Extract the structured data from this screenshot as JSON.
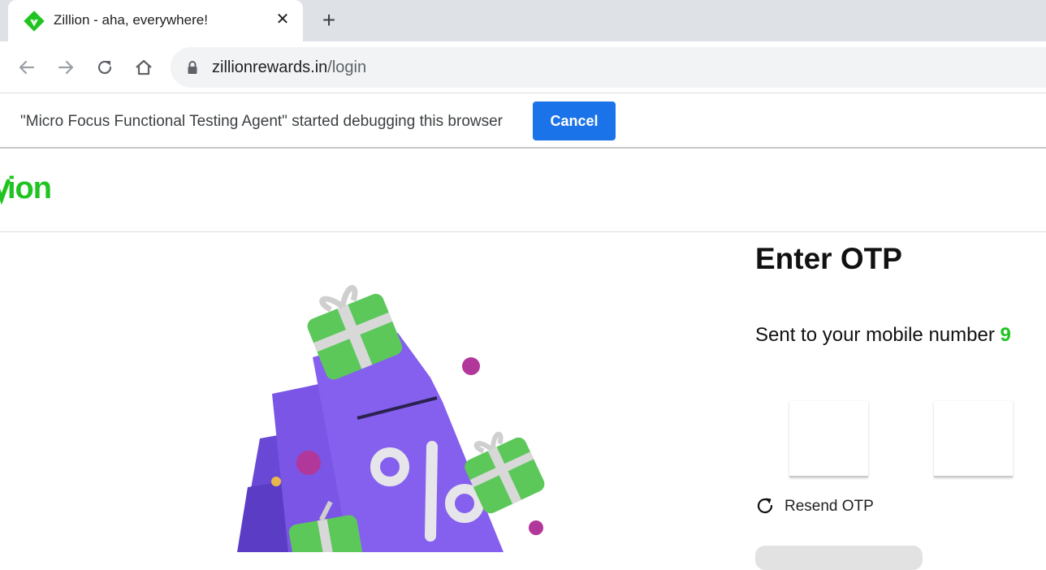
{
  "browser": {
    "tab_title": "Zillion - aha, everywhere!",
    "tab_close_icon": "close-icon",
    "new_tab_icon": "plus-icon",
    "url_host": "zillionrewards.in",
    "url_path": "/login",
    "infobar_text": "\"Micro Focus Functional Testing Agent\" started debugging this browser",
    "infobar_button": "Cancel",
    "accent": "#1a73e8"
  },
  "site": {
    "logo_text": "ion",
    "brand_color": "#1fc421"
  },
  "otp": {
    "title": "Enter OTP",
    "sent_label": "Sent to your mobile number ",
    "mobile_prefix": "9",
    "boxes": [
      "",
      ""
    ],
    "resend_label": "Resend OTP",
    "resend_icon": "refresh-icon"
  }
}
